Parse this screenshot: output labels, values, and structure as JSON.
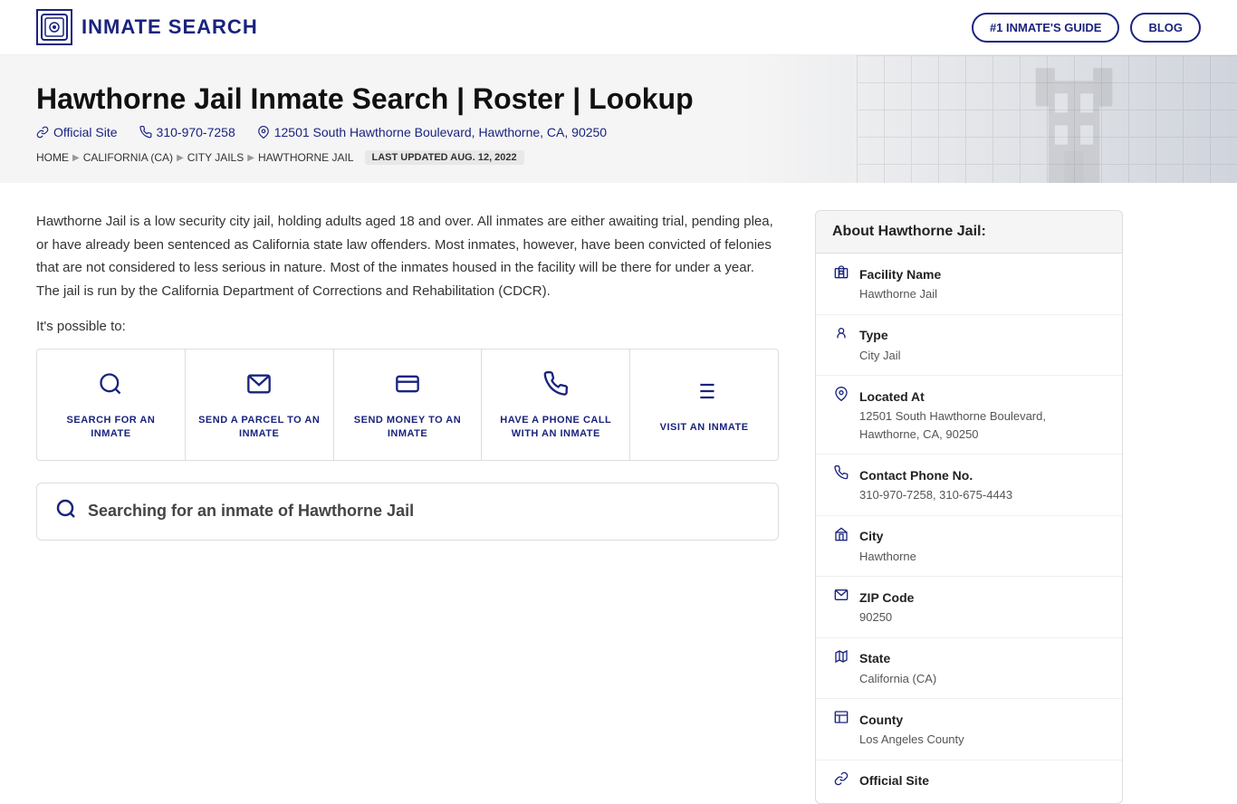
{
  "header": {
    "logo_text": "INMATE SEARCH",
    "nav": {
      "guide_label": "#1 INMATE'S GUIDE",
      "blog_label": "BLOG"
    }
  },
  "hero": {
    "title": "Hawthorne Jail Inmate Search | Roster | Lookup",
    "official_site_label": "Official Site",
    "phone": "310-970-7258",
    "address": "12501 South Hawthorne Boulevard, Hawthorne, CA, 90250",
    "breadcrumb": {
      "home": "HOME",
      "state": "CALIFORNIA (CA)",
      "category": "CITY JAILS",
      "current": "HAWTHORNE JAIL",
      "updated": "LAST UPDATED AUG. 12, 2022"
    }
  },
  "description": "Hawthorne Jail is a low security city jail, holding adults aged 18 and over. All inmates are either awaiting trial, pending plea, or have already been sentenced as California state law offenders. Most inmates, however, have been convicted of felonies that are not considered to less serious in nature. Most of the inmates housed in the facility will be there for under a year. The jail is run by the California Department of Corrections and Rehabilitation (CDCR).",
  "possible_text": "It's possible to:",
  "action_cards": [
    {
      "id": "search",
      "label": "SEARCH FOR AN INMATE",
      "icon": "🔍"
    },
    {
      "id": "parcel",
      "label": "SEND A PARCEL TO AN INMATE",
      "icon": "✉"
    },
    {
      "id": "money",
      "label": "SEND MONEY TO AN INMATE",
      "icon": "💳"
    },
    {
      "id": "phone",
      "label": "HAVE A PHONE CALL WITH AN INMATE",
      "icon": "📞"
    },
    {
      "id": "visit",
      "label": "VISIT AN INMATE",
      "icon": "📋"
    }
  ],
  "search_box": {
    "text": "Searching for an inmate of ",
    "highlight": "Hawthorne Jail"
  },
  "sidebar": {
    "title": "About Hawthorne Jail:",
    "items": [
      {
        "id": "facility-name",
        "label": "Facility Name",
        "value": "Hawthorne Jail",
        "icon": "🏛"
      },
      {
        "id": "type",
        "label": "Type",
        "value": "City Jail",
        "icon": "🔑"
      },
      {
        "id": "located-at",
        "label": "Located At",
        "value": "12501 South Hawthorne Boulevard, Hawthorne, CA, 90250",
        "icon": "📍"
      },
      {
        "id": "phone",
        "label": "Contact Phone No.",
        "value": "310-970-7258, 310-675-4443",
        "icon": "📞"
      },
      {
        "id": "city",
        "label": "City",
        "value": "Hawthorne",
        "icon": "🏙"
      },
      {
        "id": "zip",
        "label": "ZIP Code",
        "value": "90250",
        "icon": "✉"
      },
      {
        "id": "state",
        "label": "State",
        "value": "California (CA)",
        "icon": "🗺"
      },
      {
        "id": "county",
        "label": "County",
        "value": "Los Angeles County",
        "icon": "📄"
      },
      {
        "id": "official-site",
        "label": "Official Site",
        "value": "",
        "icon": "🔗"
      }
    ]
  }
}
